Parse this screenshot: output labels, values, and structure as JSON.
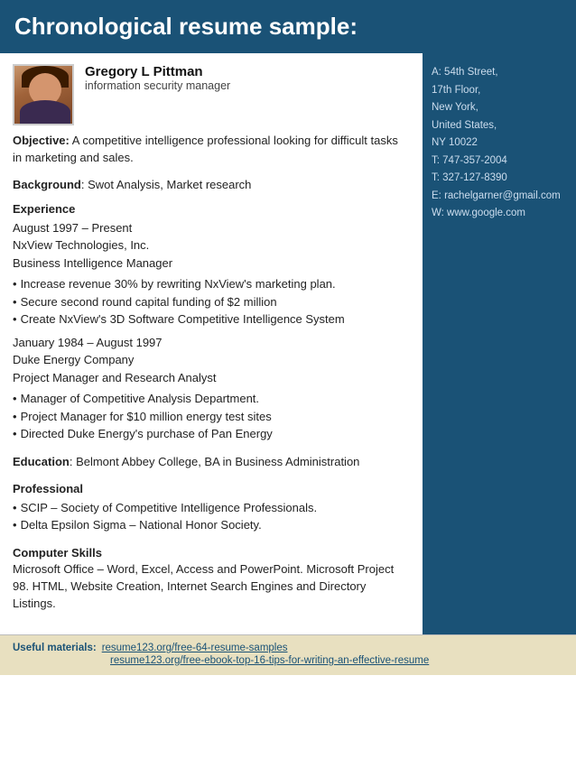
{
  "header": {
    "title": "Chronological resume sample:"
  },
  "person": {
    "name": "Gregory L Pittman",
    "job_title": "information security manager"
  },
  "sidebar": {
    "address_line1": "A: 54th Street,",
    "address_line2": "17th Floor,",
    "address_line3": "New York,",
    "address_line4": "United States,",
    "address_line5": "NY 10022",
    "phone1_label": "T:",
    "phone1": "747-357-2004",
    "phone2_label": "T:",
    "phone2": "327-127-8390",
    "email_label": "E:",
    "email": "rachelgarner@gmail.com",
    "website_label": "W:",
    "website": "www.google.com"
  },
  "objective": {
    "label": "Objective:",
    "text": "A competitive intelligence professional looking for difficult tasks in marketing and sales."
  },
  "background": {
    "label": "Background",
    "text": ": Swot Analysis, Market research"
  },
  "experience": {
    "label": "Experience",
    "jobs": [
      {
        "dates": "August 1997 – Present",
        "company": "NxView Technologies, Inc.",
        "role": "Business Intelligence Manager",
        "bullets": [
          "Increase revenue 30% by rewriting NxView's marketing plan.",
          "Secure second round capital funding of $2 million",
          "Create NxView's 3D Software Competitive Intelligence System"
        ]
      },
      {
        "dates": "January 1984 – August 1997",
        "company": "Duke Energy Company",
        "role": "Project Manager and Research Analyst",
        "bullets": [
          "Manager of Competitive Analysis Department.",
          "Project Manager for $10 million energy test sites",
          "Directed Duke Energy's purchase of Pan Energy"
        ]
      }
    ]
  },
  "education": {
    "label": "Education",
    "text": ": Belmont Abbey College, BA in Business Administration"
  },
  "professional": {
    "label": "Professional",
    "bullets": [
      "SCIP – Society of Competitive Intelligence Professionals.",
      "Delta Epsilon Sigma – National Honor Society."
    ]
  },
  "computer_skills": {
    "label": "Computer Skills",
    "text": "Microsoft Office – Word, Excel, Access and PowerPoint. Microsoft Project 98. HTML, Website Creation, Internet Search Engines and Directory Listings."
  },
  "footer": {
    "useful_label": "Useful materials:",
    "links": [
      "resume123.org/free-64-resume-samples",
      "resume123.org/free-ebook-top-16-tips-for-writing-an-effective-resume"
    ]
  }
}
